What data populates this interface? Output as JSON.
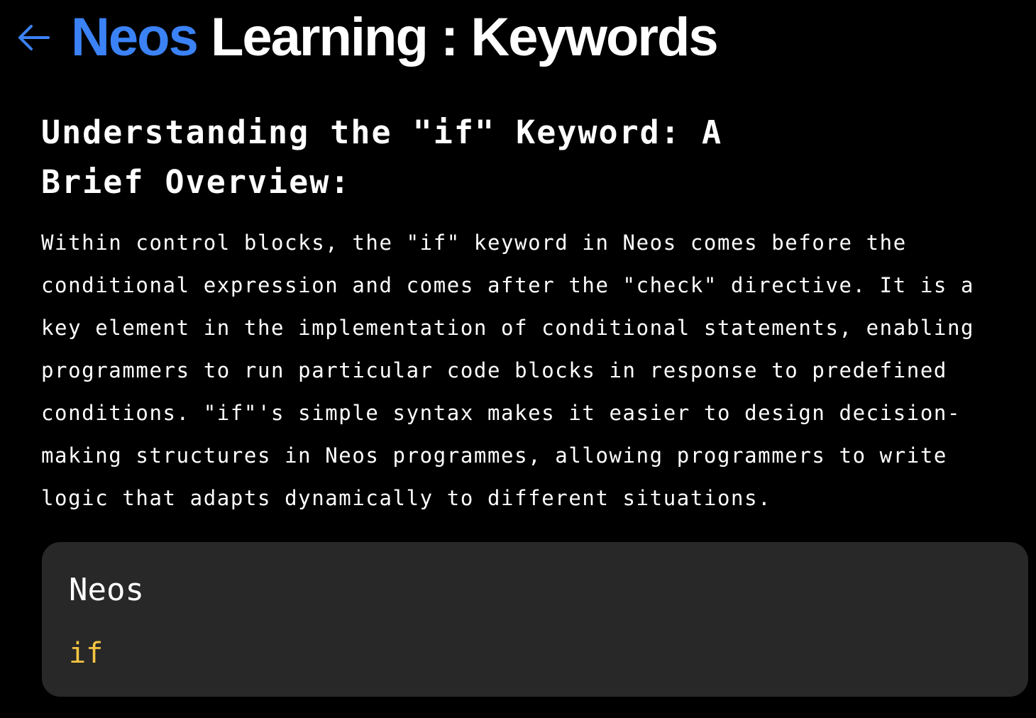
{
  "header": {
    "back_icon": "arrow-left-icon",
    "title_brand": "Neos",
    "title_rest": " Learning : Keywords"
  },
  "article": {
    "heading": "Understanding the \"if\" Keyword: A Brief Overview:",
    "body": "Within control blocks, the \"if\" keyword in Neos comes before the conditional expression and comes after the \"check\" directive. It is a key element in the implementation of conditional statements, enabling programmers to run particular code blocks in response to predefined conditions. \"if\"'s simple syntax makes it easier to design decision-making structures in Neos programmes, allowing programmers to write logic that adapts dynamically to different situations."
  },
  "code_block": {
    "language": "Neos",
    "code": "if"
  },
  "colors": {
    "background": "#000000",
    "accent": "#3b82f6",
    "card": "#282828",
    "keyword": "#f5c542"
  }
}
